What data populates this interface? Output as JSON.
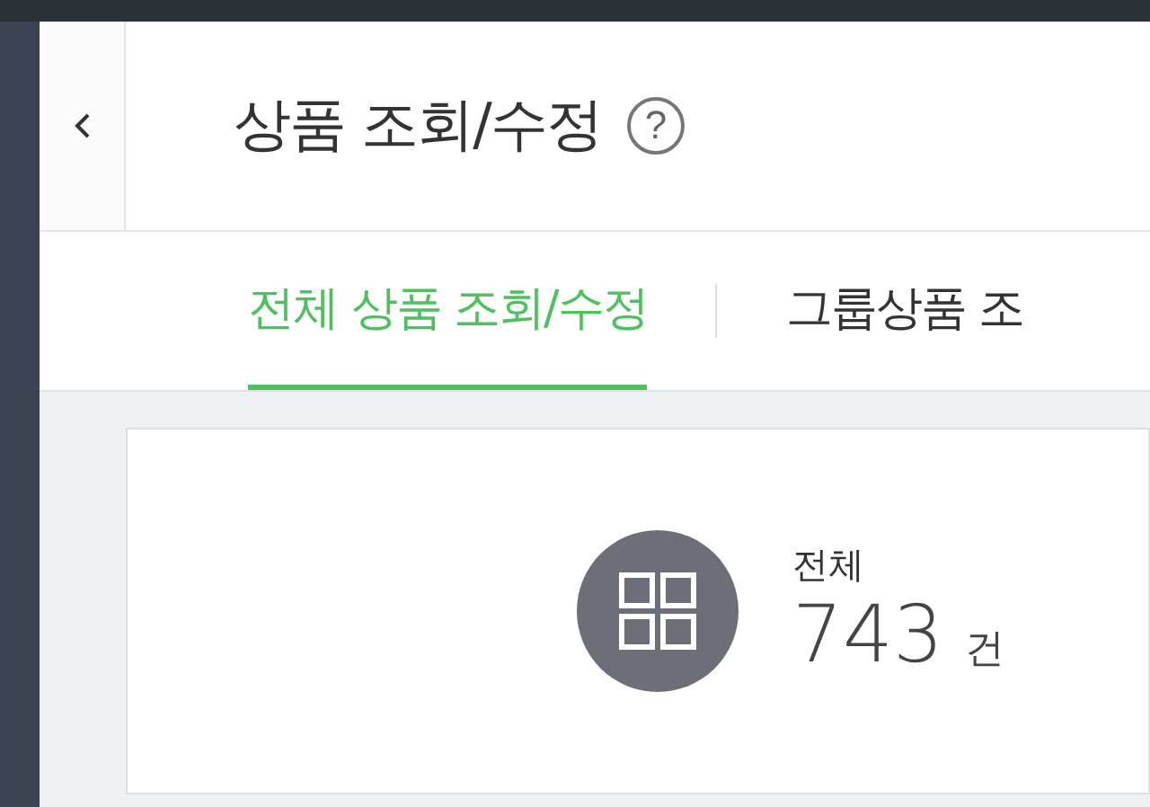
{
  "header": {
    "title": "상품 조회/수정",
    "help": "?"
  },
  "tabs": [
    {
      "label": "전체 상품 조회/수정",
      "selected": true
    },
    {
      "label": "그룹상품 조",
      "selected": false
    }
  ],
  "summary": {
    "label": "전체",
    "count": "743",
    "unit": "건"
  }
}
